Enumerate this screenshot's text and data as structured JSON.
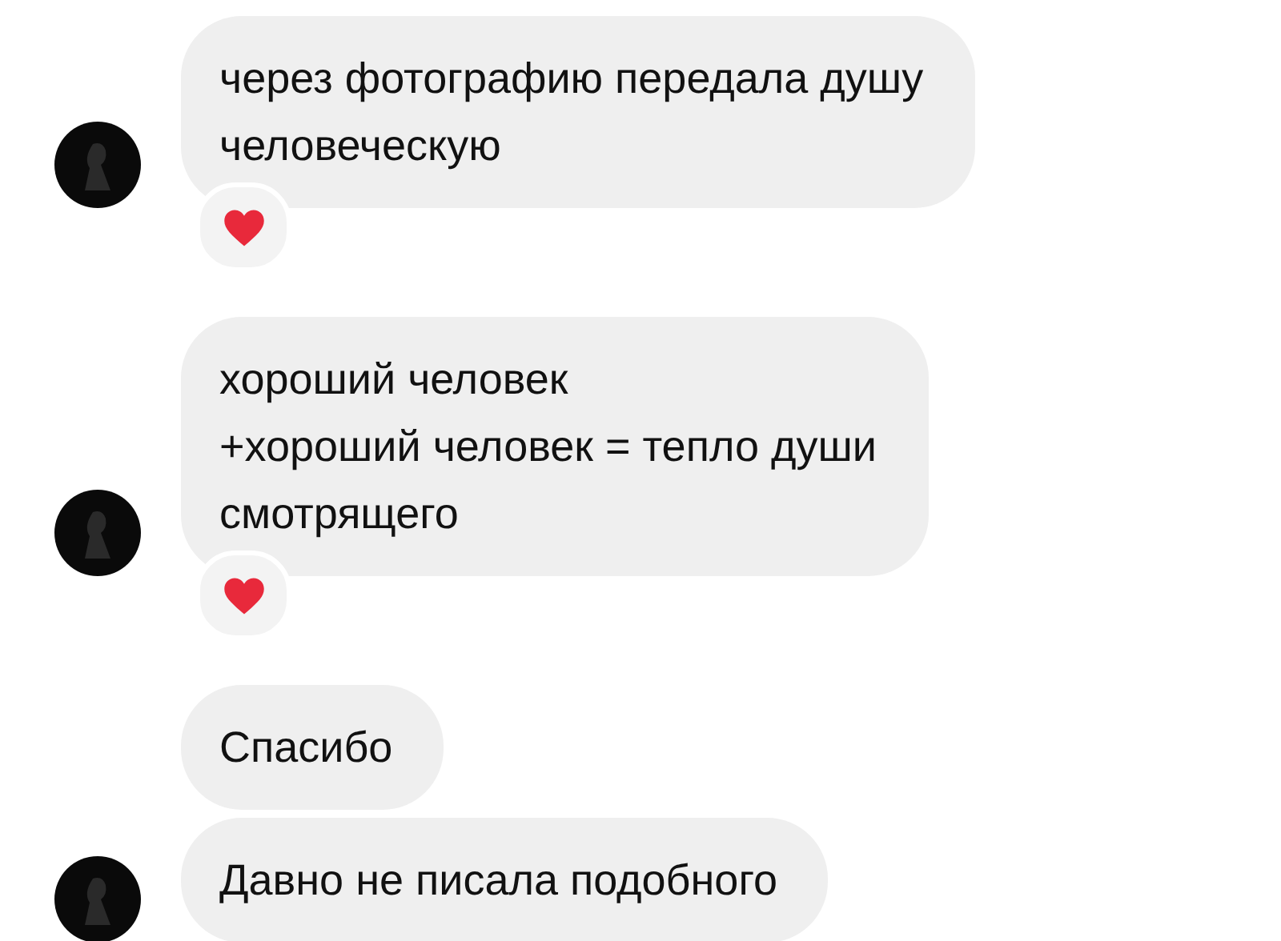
{
  "messages": [
    {
      "text": "через фотографию передала душу\nчеловеческую",
      "avatar": true,
      "reaction": {
        "kind": "heart"
      }
    },
    {
      "text": "хороший человек\n+хороший человек = тепло души\nсмотрящего",
      "avatar": true,
      "reaction": {
        "kind": "heart"
      }
    },
    {
      "text": "Спасибо",
      "avatar": false
    },
    {
      "text": "Давно не писала подобного",
      "avatar": true
    }
  ]
}
